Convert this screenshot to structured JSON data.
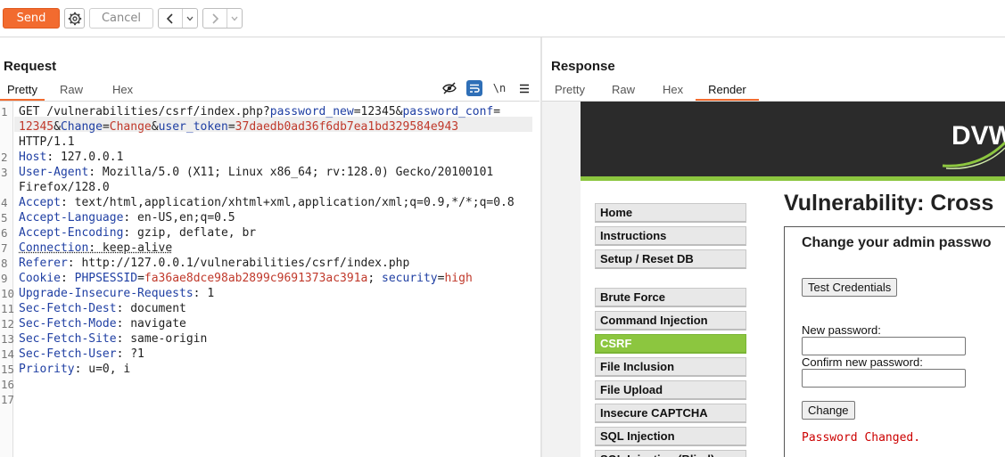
{
  "toolbar": {
    "send_label": "Send",
    "cancel_label": "Cancel",
    "back_icon": "chevron-left-icon",
    "forward_icon": "chevron-right-icon",
    "settings_icon": "gear-icon",
    "accent_color": "#f26b2f"
  },
  "request": {
    "title": "Request",
    "tabs": [
      "Pretty",
      "Raw",
      "Hex"
    ],
    "active_tab": "Pretty",
    "line_numbers": [
      "1",
      "2",
      "3",
      "4",
      "5",
      "6",
      "7",
      "8",
      "9",
      "10",
      "11",
      "12",
      "13",
      "14",
      "15",
      "16",
      "17"
    ],
    "lines": {
      "l1a_plain": "GET /vulnerabilities/csrf/index.php?",
      "l1a_k1": "password_new",
      "l1a_eq1": "=12345&",
      "l1a_k2": "password_conf",
      "l1a_eq2": "=",
      "l1b_v1": "12345",
      "l1b_amp1": "&",
      "l1b_k3": "Change",
      "l1b_eq3": "=",
      "l1b_v3": "Change",
      "l1b_amp2": "&",
      "l1b_k4": "user_token",
      "l1b_eq4": "=",
      "l1b_v4": "37daedb0ad36f6db7ea1bd329584e943",
      "l1c": "HTTP/1.1",
      "l2_k": "Host",
      "l2_v": ": 127.0.0.1",
      "l3_k": "User-Agent",
      "l3_v": ": Mozilla/5.0 (X11; Linux x86_64; rv:128.0) Gecko/20100101",
      "l3b": "Firefox/128.0",
      "l4_k": "Accept",
      "l4_v": ": text/html,application/xhtml+xml,application/xml;q=0.9,*/*;q=0.8",
      "l5_k": "Accept-Language",
      "l5_v": ": en-US,en;q=0.5",
      "l6_k": "Accept-Encoding",
      "l6_v": ": gzip, deflate, br",
      "l7_k": "Connection",
      "l7_v": ": keep-alive",
      "l8_k": "Referer",
      "l8_v": ": http://127.0.0.1/vulnerabilities/csrf/index.php",
      "l9_k": "Cookie",
      "l9_sep": ": ",
      "l9_k2": "PHPSESSID",
      "l9_eq": "=",
      "l9_v2": "fa36ae8dce98ab2899c9691373ac391a",
      "l9_semi": "; ",
      "l9_k3": "security",
      "l9_eq2": "=",
      "l9_v3": "high",
      "l10_k": "Upgrade-Insecure-Requests",
      "l10_v": ": 1",
      "l11_k": "Sec-Fetch-Dest",
      "l11_v": ": document",
      "l12_k": "Sec-Fetch-Mode",
      "l12_v": ": navigate",
      "l13_k": "Sec-Fetch-Site",
      "l13_v": ": same-origin",
      "l14_k": "Sec-Fetch-User",
      "l14_v": ": ?1",
      "l15_k": "Priority",
      "l15_v": ": u=0, i"
    },
    "icons": [
      "eye-slash-icon",
      "wrap-text-icon",
      "newline-icon",
      "menu-icon"
    ],
    "newline_label": "\\n"
  },
  "response": {
    "title": "Response",
    "tabs": [
      "Pretty",
      "Raw",
      "Hex",
      "Render"
    ],
    "active_tab": "Render"
  },
  "dvwa": {
    "logo_text": "DVWA",
    "menu": [
      "Home",
      "Instructions",
      "Setup / Reset DB",
      "Brute Force",
      "Command Injection",
      "CSRF",
      "File Inclusion",
      "File Upload",
      "Insecure CAPTCHA",
      "SQL Injection",
      "SQL Injection (Blind)"
    ],
    "selected_menu": "CSRF",
    "page_title": "Vulnerability: Cross",
    "form_heading": "Change your admin passwo",
    "test_button": "Test Credentials",
    "new_password_label": "New password:",
    "confirm_password_label": "Confirm new password:",
    "change_button": "Change",
    "status_message": "Password Changed.",
    "green_color": "#8cc63f"
  }
}
